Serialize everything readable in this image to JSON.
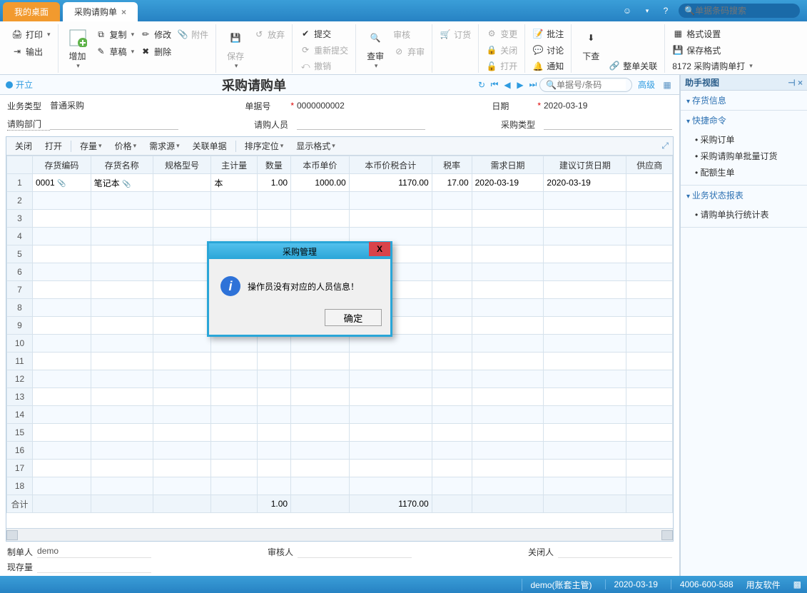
{
  "tabs": {
    "home": "我的桌面",
    "active": "采购请购单"
  },
  "search_placeholder": "单据条码搜索",
  "ribbon": {
    "print": "打印",
    "output": "输出",
    "add": "增加",
    "copy": "复制",
    "draft": "草稿",
    "modify": "修改",
    "delete": "删除",
    "attach": "附件",
    "save": "保存",
    "giveup": "放弃",
    "submit": "提交",
    "resubmit": "重新提交",
    "cancel": "撤销",
    "audit": "查审",
    "auditrec": "审核",
    "abandon": "弃审",
    "order": "订货",
    "change": "变更",
    "close": "关闭",
    "open": "打开",
    "note": "批注",
    "discuss": "讨论",
    "notify": "通知",
    "drill": "下查",
    "fulllink": "整单关联",
    "format": "格式设置",
    "saveformat": "保存格式",
    "template": "8172 采购请购单打"
  },
  "doc": {
    "status": "开立",
    "title": "采购请购单",
    "search_placeholder": "单据号/条码",
    "advanced": "高级",
    "fields": {
      "biztype_l": "业务类型",
      "biztype_v": "普通采购",
      "docno_l": "单据号",
      "docno_v": "0000000002",
      "date_l": "日期",
      "date_v": "2020-03-19",
      "dept_l": "请购部门",
      "dept_v": "",
      "person_l": "请购人员",
      "person_v": "",
      "ptype_l": "采购类型",
      "ptype_v": ""
    }
  },
  "grid": {
    "toolbar": {
      "close": "关闭",
      "open": "打开",
      "stock": "存量",
      "price": "价格",
      "source": "需求源",
      "related": "关联单据",
      "sort": "排序定位",
      "display": "显示格式"
    },
    "cols": [
      "存货编码",
      "存货名称",
      "规格型号",
      "主计量",
      "数量",
      "本币单价",
      "本币价税合计",
      "税率",
      "需求日期",
      "建议订货日期",
      "供应商"
    ],
    "row": {
      "code": "0001",
      "name": "笔记本",
      "spec": "",
      "uom": "本",
      "qty": "1.00",
      "price": "1000.00",
      "amount": "1170.00",
      "tax": "17.00",
      "reqdate": "2020-03-19",
      "suggdate": "2020-03-19",
      "vendor": ""
    },
    "sum_label": "合计",
    "sum_qty": "1.00",
    "sum_amount": "1170.00"
  },
  "footer": {
    "maker_l": "制单人",
    "maker_v": "demo",
    "auditor_l": "审核人",
    "auditor_v": "",
    "closer_l": "关闭人",
    "closer_v": "",
    "onhand_l": "现存量",
    "onhand_v": ""
  },
  "side": {
    "title": "助手视图",
    "sec1": "存货信息",
    "sec2": "快捷命令",
    "sec2_items": [
      "采购订单",
      "采购请购单批量订货",
      "配额生单"
    ],
    "sec3": "业务状态报表",
    "sec3_items": [
      "请购单执行统计表"
    ]
  },
  "modal": {
    "title": "采购管理",
    "msg": "操作员没有对应的人员信息！",
    "ok": "确定"
  },
  "status": {
    "user": "demo(账套主管)",
    "date": "2020-03-19",
    "phone": "4006-600-588",
    "brand": "用友软件"
  }
}
